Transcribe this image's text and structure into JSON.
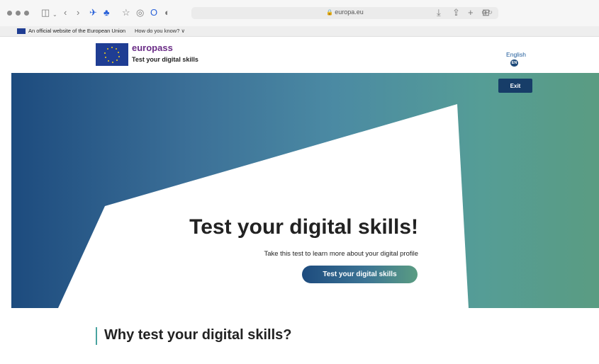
{
  "browser": {
    "url": "europa.eu",
    "icons": [
      "traffic-lights",
      "sidebar-icon",
      "back-icon",
      "forward-icon",
      "pin-icon",
      "extension-icon",
      "star-icon",
      "privacy-icon",
      "opera-icon",
      "shield-icon",
      "translate-icon",
      "download-icon",
      "share-icon",
      "new-tab-icon",
      "tab-overview-icon"
    ]
  },
  "eu_banner": {
    "text": "An official website of the European Union",
    "link": "How do you know? ∨"
  },
  "header": {
    "brand": "europass",
    "subtitle": "Test your digital skills",
    "language": "English",
    "language_code": "EN"
  },
  "hero": {
    "exit_label": "Exit",
    "title": "Test your digital skills!",
    "description": "Take this test to learn more about your digital profile",
    "cta_label": "Test your digital skills"
  },
  "section": {
    "title": "Why test your digital skills?"
  },
  "colors": {
    "brand_purple": "#6a2c86",
    "hero_start": "#1d4b7e",
    "hero_end": "#5a9c82",
    "eu_blue": "#1f3d93",
    "accent": "#4aa3a0"
  }
}
